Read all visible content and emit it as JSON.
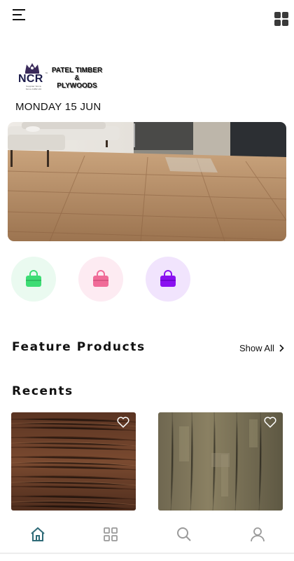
{
  "header": {
    "menu_icon": "hamburger-icon",
    "grid_icon": "grid-icon"
  },
  "logo": {
    "mark": "NCR",
    "tm": "™",
    "tiny_line1": "Supplier Since",
    "tiny_line2": "Since 1982 Ltd",
    "line1": "PATEL TIMBER",
    "line2": "&",
    "line3": "PLYWOODS"
  },
  "date": "MONDAY 15 JUN",
  "categories": [
    {
      "icon": "shopping-bag-icon",
      "color": "#3ddc74"
    },
    {
      "icon": "shopping-bag-icon",
      "color": "#f06b98"
    },
    {
      "icon": "shopping-bag-icon",
      "color": "#8a10f0"
    }
  ],
  "feature": {
    "title": "Feature Products",
    "show_all": "Show All"
  },
  "recents": {
    "title": "Recents",
    "items": [
      {
        "texture": "dark-wood",
        "favorite_icon": "heart-icon"
      },
      {
        "texture": "grey-wood",
        "favorite_icon": "heart-icon"
      }
    ]
  },
  "bottom_nav": {
    "items": [
      {
        "icon": "home-icon",
        "active": true,
        "color": "#2f6b78"
      },
      {
        "icon": "categories-icon",
        "active": false,
        "color": "#9a9a9a"
      },
      {
        "icon": "search-icon",
        "active": false,
        "color": "#9a9a9a"
      },
      {
        "icon": "profile-icon",
        "active": false,
        "color": "#9a9a9a"
      }
    ]
  }
}
